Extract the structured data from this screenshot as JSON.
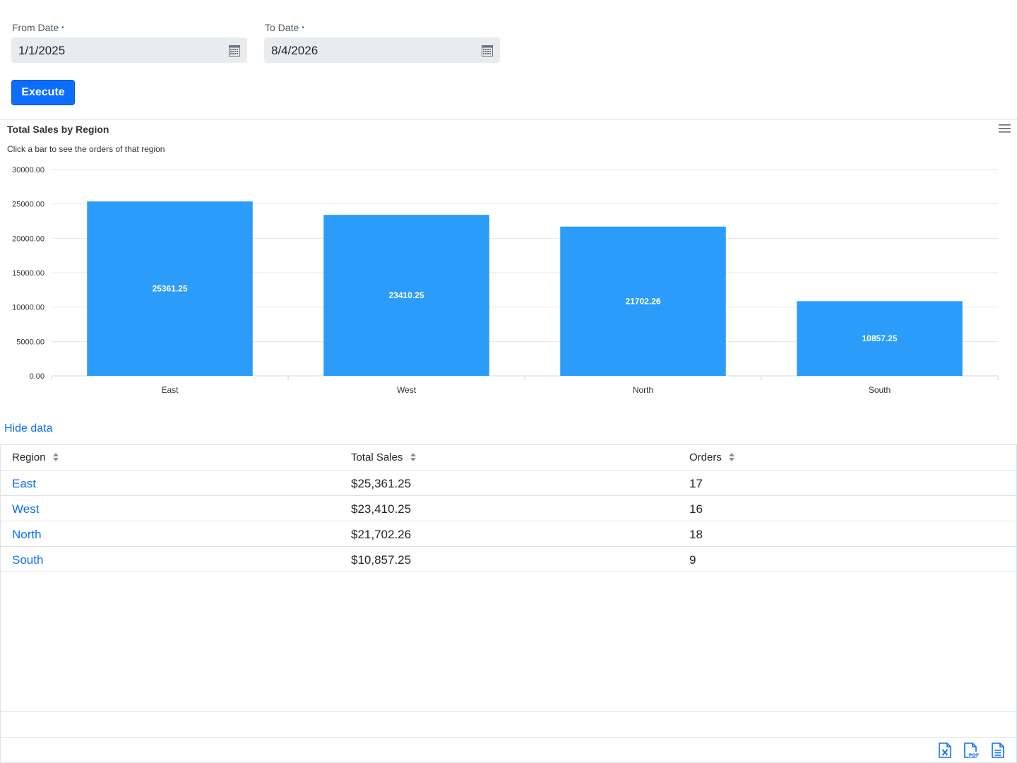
{
  "filters": {
    "from_label": "From Date",
    "from_value": "1/1/2025",
    "to_label": "To Date",
    "to_value": "8/4/2026",
    "required_marker": "•",
    "execute_label": "Execute"
  },
  "chart": {
    "title": "Total Sales by Region",
    "subtitle": "Click a bar to see the orders of that region",
    "menu_icon": "hamburger-menu-icon"
  },
  "chart_data": {
    "type": "bar",
    "title": "Total Sales by Region",
    "subtitle": "Click a bar to see the orders of that region",
    "categories": [
      "East",
      "West",
      "North",
      "South"
    ],
    "values": [
      25361.25,
      23410.25,
      21702.26,
      10857.25
    ],
    "data_labels": [
      "25361.25",
      "23410.25",
      "21702.26",
      "10857.25"
    ],
    "ylim": [
      0,
      30000
    ],
    "yticks": [
      "0.00",
      "5000.00",
      "10000.00",
      "15000.00",
      "20000.00",
      "25000.00",
      "30000.00"
    ],
    "xlabel": "",
    "ylabel": "",
    "grid": true,
    "bar_color": "#2b9cf9"
  },
  "data_toggle": {
    "label": "Hide data"
  },
  "table": {
    "columns": [
      "Region",
      "Total Sales",
      "Orders"
    ],
    "rows": [
      {
        "region": "East",
        "total_sales": "$25,361.25",
        "orders": "17"
      },
      {
        "region": "West",
        "total_sales": "$23,410.25",
        "orders": "16"
      },
      {
        "region": "North",
        "total_sales": "$21,702.26",
        "orders": "18"
      },
      {
        "region": "South",
        "total_sales": "$10,857.25",
        "orders": "9"
      }
    ]
  },
  "exports": {
    "icons": [
      "excel-export-icon",
      "pdf-export-icon",
      "text-export-icon"
    ]
  },
  "colors": {
    "accent": "#0d6efd",
    "bar": "#2b9cf9",
    "input_bg": "#e9ecef"
  }
}
